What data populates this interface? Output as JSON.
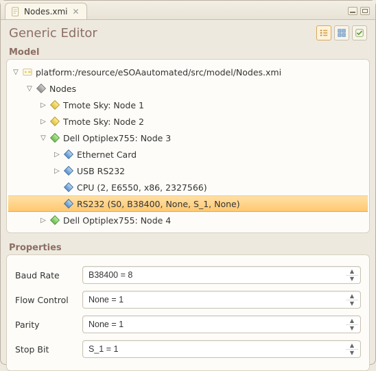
{
  "tab": {
    "title": "Nodes.xmi"
  },
  "title": "Generic Editor",
  "sections": {
    "model": "Model",
    "properties": "Properties"
  },
  "tree": {
    "root": "platform:/resource/eSOAautomated/src/model/Nodes.xmi",
    "nodes_label": "Nodes",
    "node1": "Tmote Sky: Node 1",
    "node2": "Tmote Sky: Node 2",
    "node3": "Dell Optiplex755: Node 3",
    "node3_children": {
      "eth": "Ethernet Card",
      "usb": "USB RS232",
      "cpu": "CPU (2, E6550, x86, 2327566)",
      "rs232": "RS232 (S0, B38400, None, S_1, None)"
    },
    "node4": "Dell Optiplex755: Node 4"
  },
  "properties": {
    "labels": {
      "baud": "Baud Rate",
      "flow": "Flow Control",
      "parity": "Parity",
      "stop": "Stop Bit"
    },
    "values": {
      "baud": "B38400 = 8",
      "flow": "None = 1",
      "parity": "None = 1",
      "stop": "S_1 = 1"
    }
  }
}
